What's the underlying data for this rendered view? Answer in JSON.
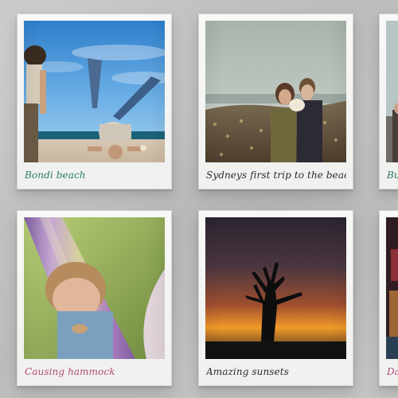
{
  "polaroids": [
    {
      "caption": "Bondi beach"
    },
    {
      "caption": "Sydneys first trip to the beach!"
    },
    {
      "caption": "Bu"
    },
    {
      "caption": "Causing hammock"
    },
    {
      "caption": "Amazing sunsets"
    },
    {
      "caption": "Da"
    }
  ],
  "colors": {
    "background": "#c0c0bf",
    "polaroid_frame": "#f4f5f3",
    "caption_teal": "#2b5f59",
    "caption_pink": "#b24b7a",
    "caption_dark": "#2a2a2a"
  }
}
